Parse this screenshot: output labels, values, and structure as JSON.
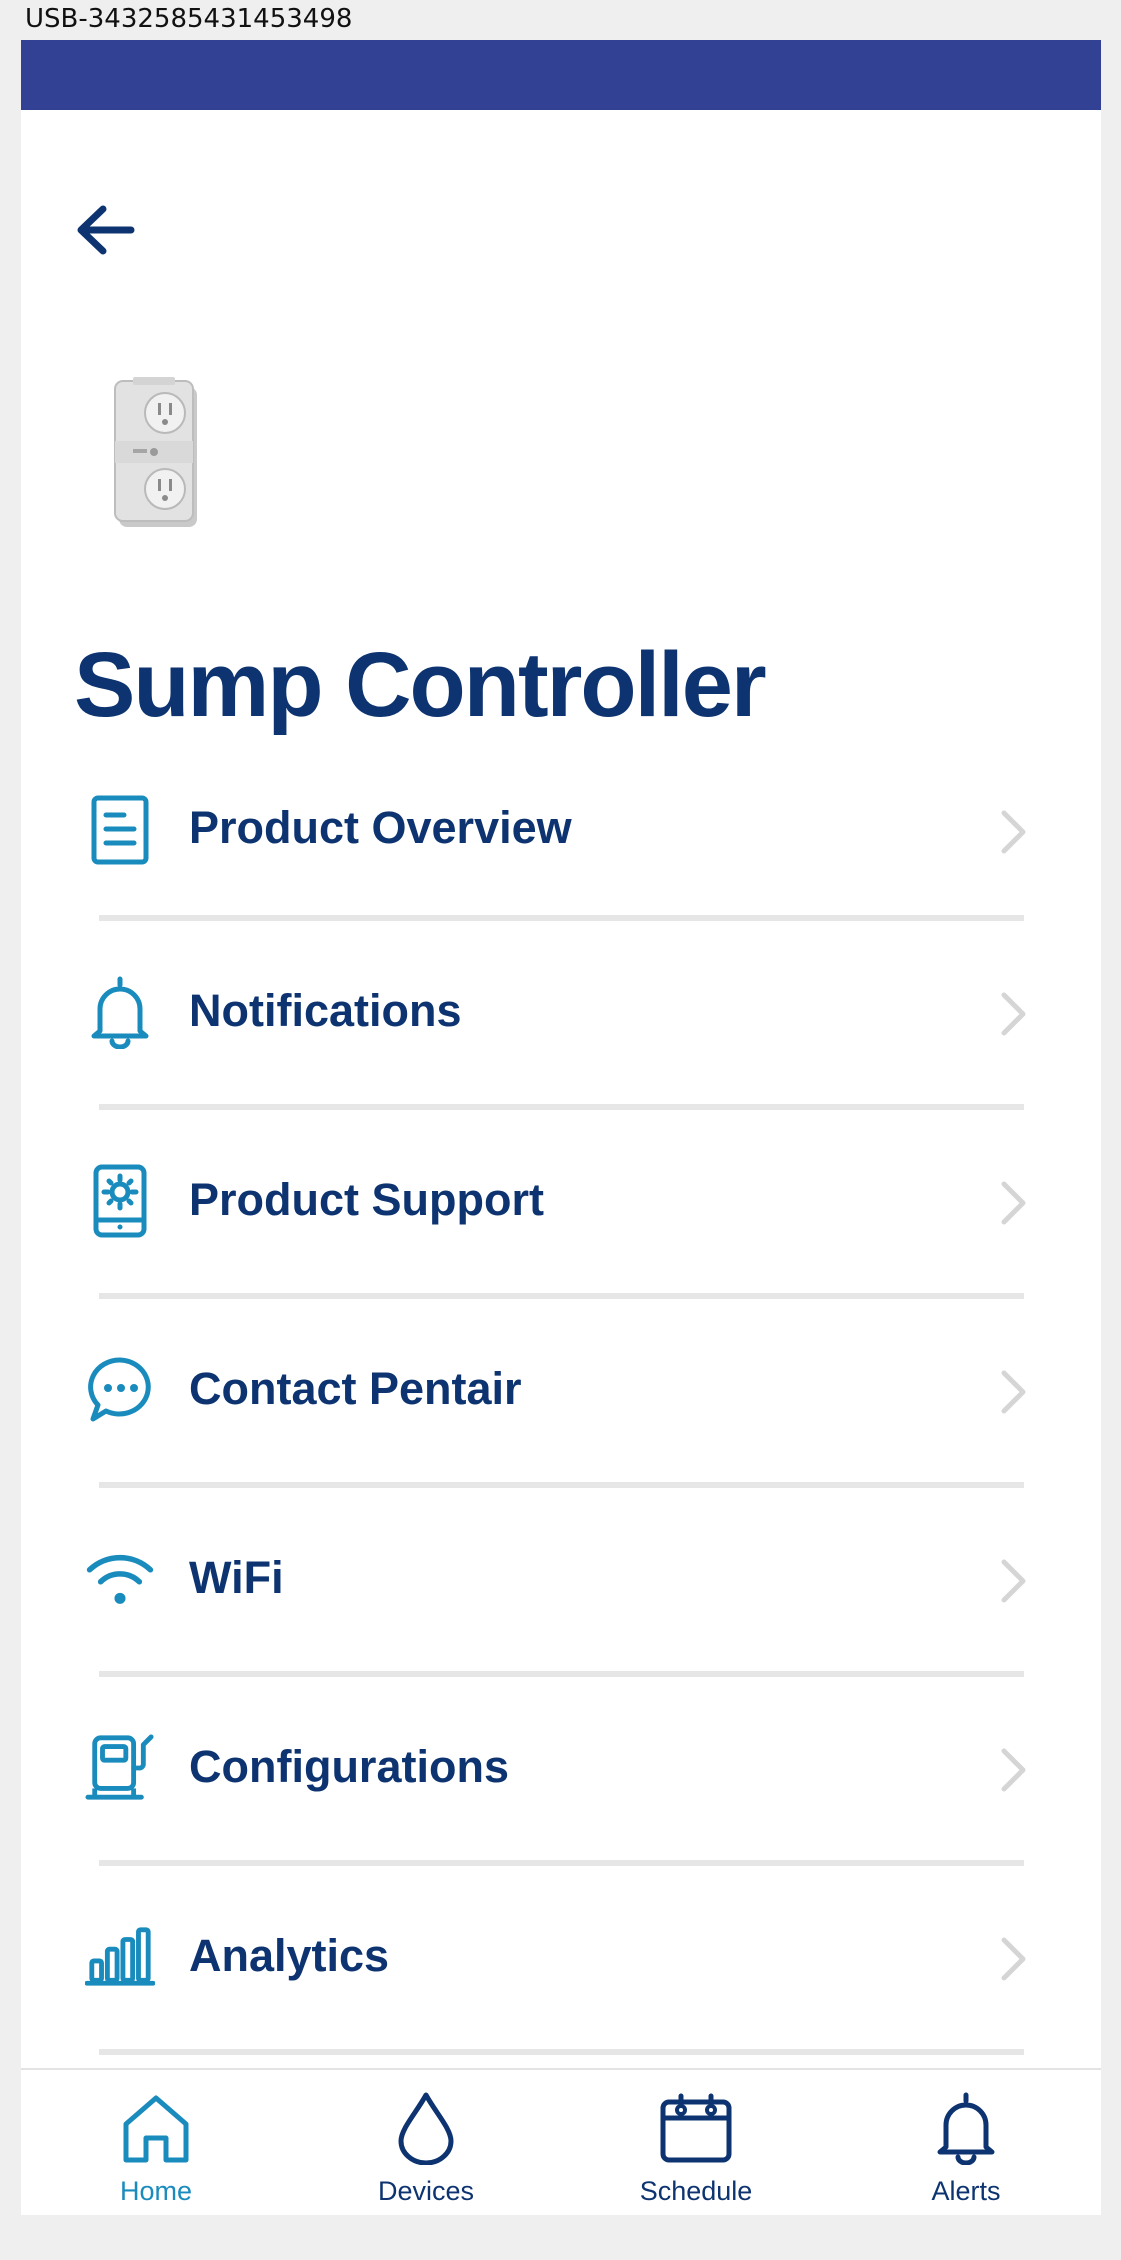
{
  "device_label": "USB-3432585431453498",
  "colors": {
    "status_bar": "#334195",
    "title_navy": "#0d3470",
    "icon_teal": "#1a8bbd",
    "divider": "#e6e6e6",
    "chevron": "#d5d5d5"
  },
  "header": {
    "back_icon": "arrow-left-icon",
    "product_image": "outlet-controller-image"
  },
  "page_title": "Sump Controller",
  "menu": [
    {
      "label": "Product Overview",
      "icon": "document-icon"
    },
    {
      "label": "Notifications",
      "icon": "bell-icon"
    },
    {
      "label": "Product Support",
      "icon": "tablet-gear-icon"
    },
    {
      "label": "Contact Pentair",
      "icon": "chat-bubble-icon"
    },
    {
      "label": "WiFi",
      "icon": "wifi-icon"
    },
    {
      "label": "Configurations",
      "icon": "fuel-pump-icon"
    },
    {
      "label": "Analytics",
      "icon": "bar-chart-icon"
    }
  ],
  "bottom_nav": [
    {
      "label": "Home",
      "icon": "home-icon",
      "active": true
    },
    {
      "label": "Devices",
      "icon": "water-drop-icon",
      "active": false
    },
    {
      "label": "Schedule",
      "icon": "calendar-icon",
      "active": false
    },
    {
      "label": "Alerts",
      "icon": "bell-icon",
      "active": false
    }
  ]
}
